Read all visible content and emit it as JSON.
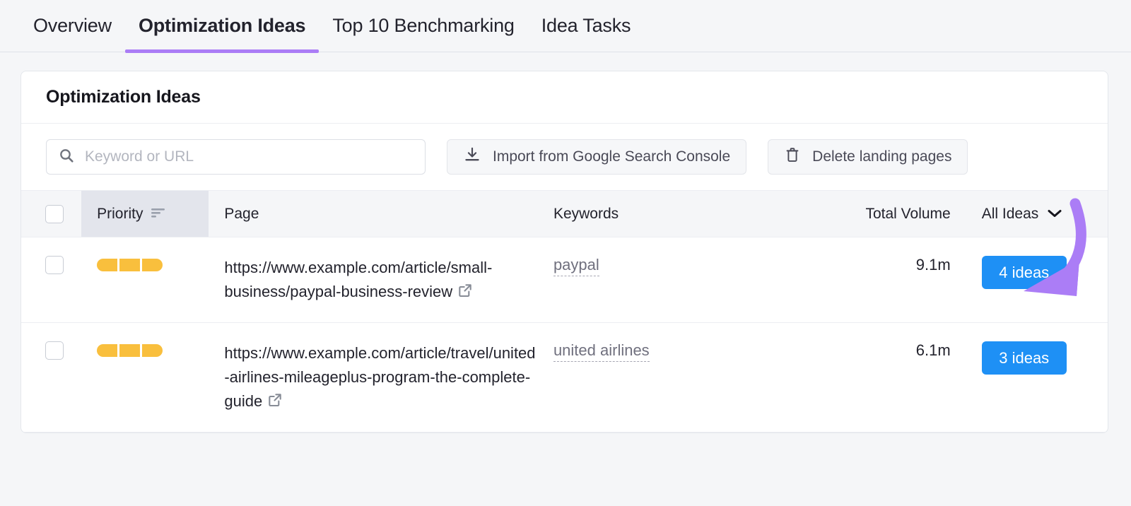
{
  "tabs": [
    {
      "label": "Overview",
      "active": false
    },
    {
      "label": "Optimization Ideas",
      "active": true
    },
    {
      "label": "Top 10 Benchmarking",
      "active": false
    },
    {
      "label": "Idea Tasks",
      "active": false
    }
  ],
  "card": {
    "title": "Optimization Ideas"
  },
  "toolbar": {
    "search_placeholder": "Keyword or URL",
    "search_value": "",
    "search_icon": "search-icon",
    "import_label": "Import from Google Search Console",
    "import_icon": "download-icon",
    "delete_label": "Delete landing pages",
    "delete_icon": "trash-icon"
  },
  "table": {
    "columns": {
      "priority": "Priority",
      "page": "Page",
      "keywords": "Keywords",
      "total_volume": "Total Volume",
      "ideas_filter": "All Ideas"
    },
    "sort_icon": "sort-descending-icon",
    "filter_chevron_icon": "chevron-down-icon",
    "rows": [
      {
        "priority_segments": 3,
        "url": "https://www.example.com/article/small-business/paypal-business-review",
        "external_link_icon": "external-link-icon",
        "keyword": "paypal",
        "total_volume": "9.1m",
        "ideas_label": "4 ideas"
      },
      {
        "priority_segments": 3,
        "url": "https://www.example.com/article/travel/united-airlines-mileageplus-program-the-complete-guide",
        "external_link_icon": "external-link-icon",
        "keyword": "united airlines",
        "total_volume": "6.1m",
        "ideas_label": "3 ideas"
      }
    ]
  },
  "annotation": {
    "arrow_icon": "curved-arrow-annotation",
    "color": "#ab7df6",
    "points_at": "4 ideas"
  },
  "colors": {
    "accent_purple": "#ab7df6",
    "ideas_blue": "#1e90f5",
    "priority_amber": "#f9bf3d",
    "page_background": "#f5f6f8"
  }
}
